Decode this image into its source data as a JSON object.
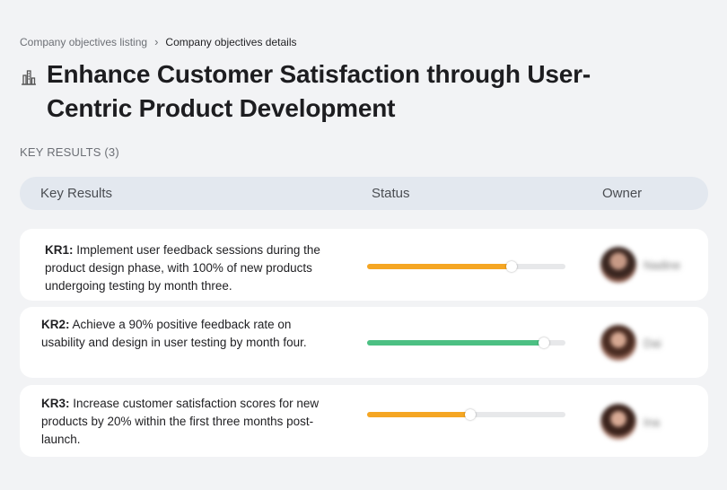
{
  "breadcrumb": {
    "parent": "Company objectives listing",
    "separator": "›",
    "current": "Company objectives details"
  },
  "page": {
    "title": "Enhance Customer Satisfaction through User-Centric Product Development",
    "icon": "building-chart-icon"
  },
  "key_results_label": "KEY RESULTS (3)",
  "table": {
    "headers": [
      "Key Results",
      "Status",
      "Owner"
    ]
  },
  "key_results": [
    {
      "id": "KR1:",
      "text": " Implement user feedback sessions during the product design phase, with 100% of new products undergoing testing by month three.",
      "progress": 0.73,
      "color": "#f5a623",
      "owner": "Nadine"
    },
    {
      "id": "KR2:",
      "text": " Achieve a 90% positive feedback rate on usability and design in user testing by month four.",
      "progress": 0.89,
      "color": "#4cc083",
      "owner": "Dai"
    },
    {
      "id": "KR3:",
      "text": " Increase customer satisfaction scores for new products by 20% within the first three months post-launch.",
      "progress": 0.52,
      "color": "#f5a623",
      "owner": "Ina"
    }
  ],
  "colors": {
    "background": "#f2f3f5",
    "header_bg": "#e3e8ef",
    "card_bg": "#ffffff"
  }
}
